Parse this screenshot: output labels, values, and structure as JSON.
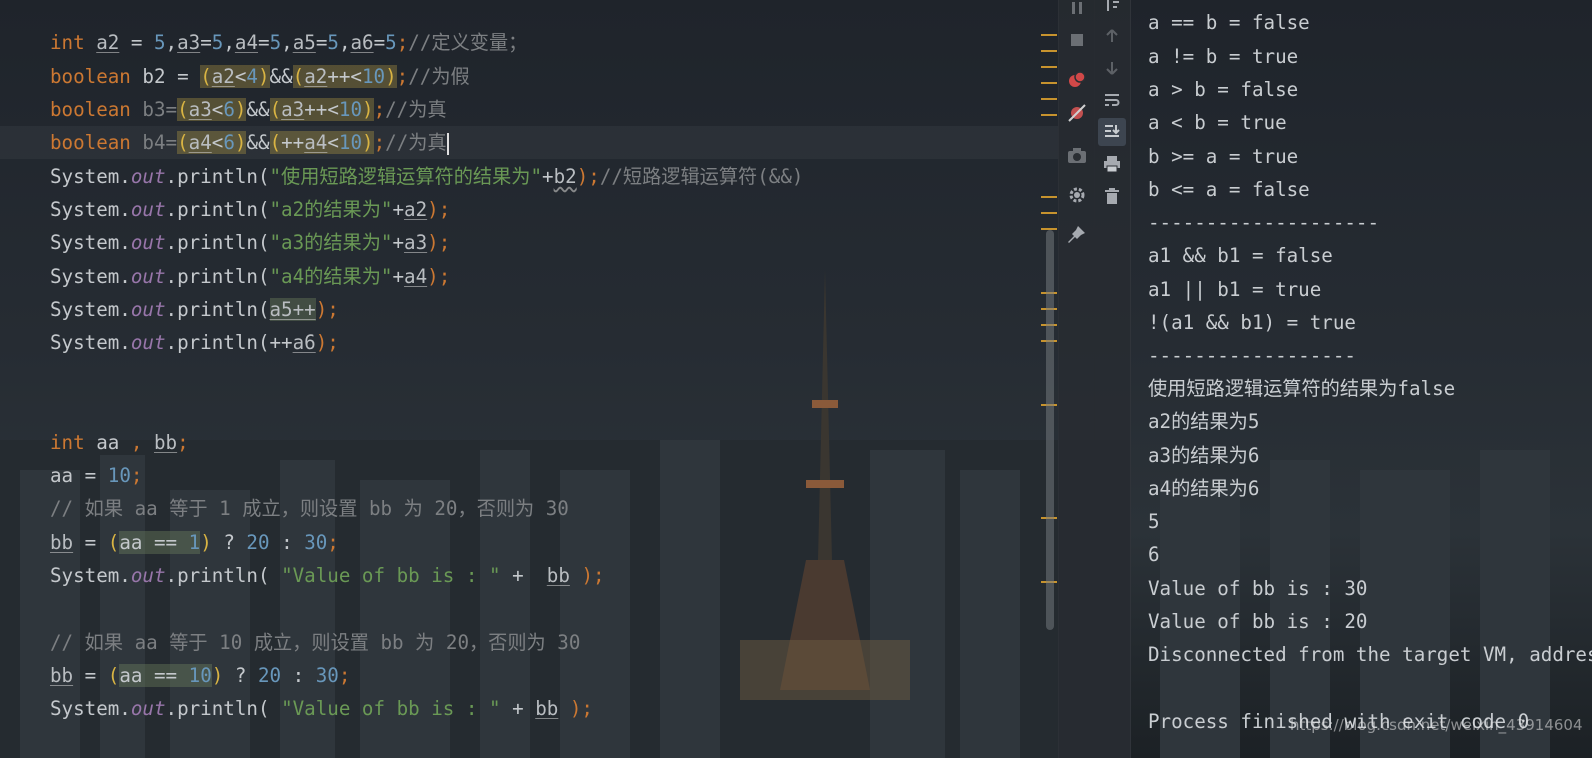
{
  "editor": {
    "line1": {
      "kw_int": "int",
      "a2": "a2",
      "eq1": " = ",
      "n1": "5",
      "c1": ",",
      "a3": "a3",
      "eq2": "=",
      "n2": "5",
      "c2": ",",
      "a4": "a4",
      "eq3": "=",
      "n3": "5",
      "c3": ",",
      "a5": "a5",
      "eq4": "=",
      "n4": "5",
      "c4": ",",
      "a6": "a6",
      "eq5": "=",
      "n5": "5",
      "semi": ";",
      "comment": "//定义变量；"
    },
    "line2": {
      "kw": "boolean",
      "name": " b2 = ",
      "lp1": "(",
      "a2": "a2",
      "op1": "<",
      "n1": "4",
      "rp1": ")",
      "and": "&&",
      "lp2": "(",
      "a2b": "a2",
      "op2": "++<",
      "n2": "10",
      "rp2": ")",
      "semi": ";",
      "comment": "//为假"
    },
    "line3": {
      "kw": "boolean",
      "name": " b3=",
      "lp1": "(",
      "a3": "a3",
      "op1": "<",
      "n1": "6",
      "rp1": ")",
      "and": "&&",
      "lp2": "(",
      "a3b": "a3",
      "op2": "++<",
      "n2": "10",
      "rp2": ")",
      "semi": ";",
      "comment": "//为真"
    },
    "line4": {
      "kw": "boolean",
      "name": " b4=",
      "lp1": "(",
      "a4": "a4",
      "op1": "<",
      "n1": "6",
      "rp1": ")",
      "and": "&&",
      "lp2": "(",
      "op2": "++",
      "a4b": "a4",
      "op3": "<",
      "n2": "10",
      "rp2": ")",
      "semi": ";",
      "comment": "//为真"
    },
    "line5": {
      "sys": "System.",
      "out": "out",
      "println": ".println(",
      "str": "\"使用短路逻辑运算符的结果为\"",
      "plus": "+",
      "b2": "b2",
      "close": ");",
      "comment": "//短路逻辑运算符(&&)"
    },
    "line6": {
      "sys": "System.",
      "out": "out",
      "println": ".println(",
      "str": "\"a2的结果为\"",
      "plus": "+",
      "var": "a2",
      "close": ");"
    },
    "line7": {
      "sys": "System.",
      "out": "out",
      "println": ".println(",
      "str": "\"a3的结果为\"",
      "plus": "+",
      "var": "a3",
      "close": ");"
    },
    "line8": {
      "sys": "System.",
      "out": "out",
      "println": ".println(",
      "str": "\"a4的结果为\"",
      "plus": "+",
      "var": "a4",
      "close": ");"
    },
    "line9": {
      "sys": "System.",
      "out": "out",
      "println": ".println(",
      "var": "a5++",
      "close": ");"
    },
    "line10": {
      "sys": "System.",
      "out": "out",
      "println": ".println(",
      "pre": "++",
      "var": "a6",
      "close": ");"
    },
    "line11": {
      "kw": "int",
      "aa": " aa ",
      "comma": ",",
      "sp": " ",
      "bb": "bb",
      "semi": ";"
    },
    "line12": {
      "aa": "aa = ",
      "num": "10",
      "semi": ";"
    },
    "line13": {
      "comment": "// 如果 aa 等于 1 成立，则设置 bb 为 20，否则为 30"
    },
    "line14": {
      "bb": "bb",
      "eq": " = ",
      "lp": "(",
      "cond": "aa == ",
      "n1": "1",
      "rp": ")",
      "q": " ? ",
      "n2": "20",
      "colon": " : ",
      "n3": "30",
      "semi": ";"
    },
    "line15": {
      "sys": "System.",
      "out": "out",
      "println": ".println(",
      "sp1": " ",
      "str": "\"Value of bb is : \"",
      "plus": " +  ",
      "bb": "bb",
      "close": " );"
    },
    "line16": {
      "comment": "// 如果 aa 等于 10 成立，则设置 bb 为 20，否则为 30"
    },
    "line17": {
      "bb": "bb",
      "eq": " = ",
      "lp": "(",
      "cond": "aa == ",
      "n1": "10",
      "rp": ")",
      "q": " ? ",
      "n2": "20",
      "colon": " : ",
      "n3": "30",
      "semi": ";"
    },
    "line18": {
      "sys": "System.",
      "out": "out",
      "println": ".println(",
      "sp1": " ",
      "str": "\"Value of bb is : \"",
      "plus": " + ",
      "bb": "bb",
      "close": " );"
    }
  },
  "console": {
    "lines": [
      "a == b = false",
      "a != b = true",
      "a > b = false",
      "a < b = true",
      "b >= a = true",
      "b <= a = false",
      "--------------------",
      "a1 && b1 = false",
      "a1 || b1 = true",
      "!(a1 && b1) = true",
      "------------------",
      "使用短路逻辑运算符的结果为false",
      "a2的结果为5",
      "a3的结果为6",
      "a4的结果为6",
      "5",
      "6",
      "Value of bb is : 30",
      "Value of bb is : 20",
      "Disconnected from the target VM, address",
      "",
      "Process finished with exit code 0"
    ]
  },
  "toolbar": {
    "icons": [
      "pause-icon",
      "stop-icon",
      "up-arrow-icon",
      "down-arrow-icon",
      "breakpoint-icon",
      "mute-breakpoints-icon",
      "soft-wrap-icon",
      "scroll-to-end-icon",
      "camera-icon",
      "print-icon",
      "settings-icon",
      "trash-icon",
      "pin-icon"
    ]
  },
  "watermark": "https://blog.csdn.net/weixin_43914604",
  "colors": {
    "keyword": "#cc7832",
    "number": "#6897bb",
    "string": "#6a9955",
    "comment": "#7c7f82",
    "field": "#9876aa",
    "paren": "#d9b443",
    "marker": "#c7932e"
  }
}
